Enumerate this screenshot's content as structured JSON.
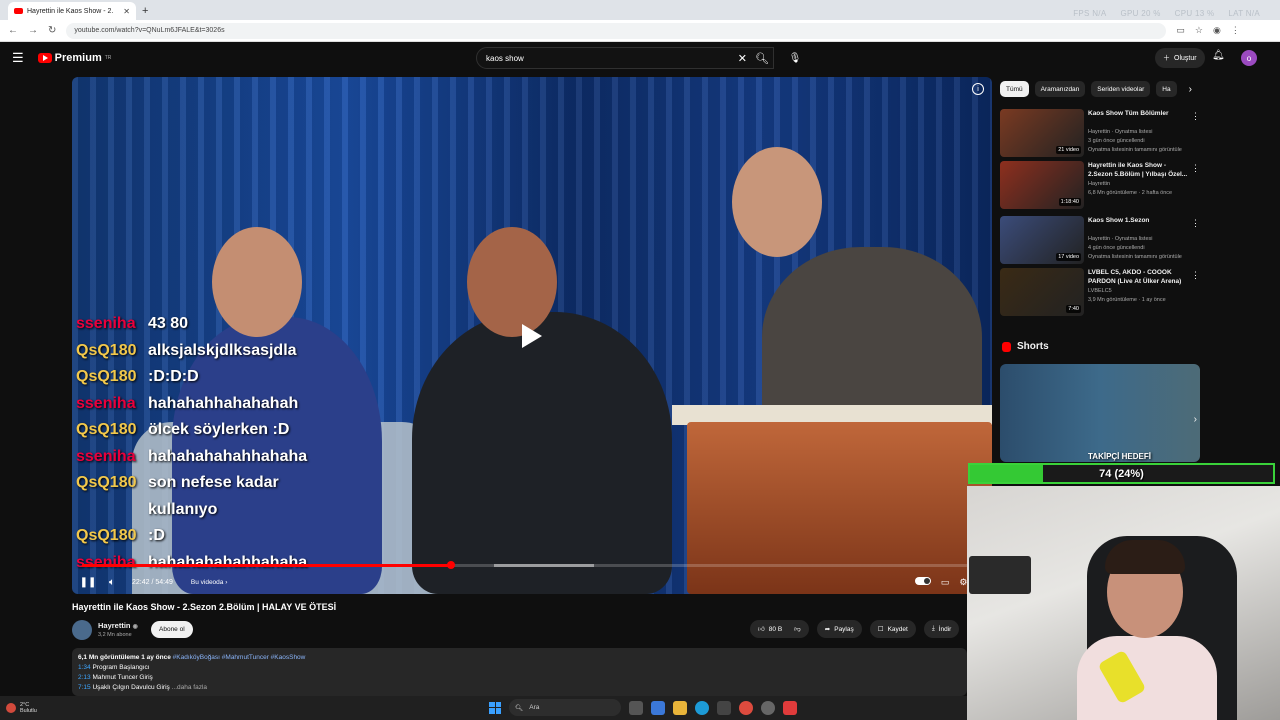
{
  "browser": {
    "tab_title": "Hayrettin ile Kaos Show - 2.",
    "url": "youtube.com/watch?v=QNuLm6JFALE&t=3026s",
    "perf": [
      "FPS N/A",
      "GPU 20 %",
      "CPU 13 %",
      "LAT N/A"
    ]
  },
  "header": {
    "logo_text": "Premium",
    "logo_sup": "TR",
    "search_value": "kaos show",
    "create_label": "Oluştur",
    "avatar_letter": "o"
  },
  "video": {
    "progress_fraction": 0.41,
    "time": "22:42 / 54:49",
    "chapter": "Bu videoda",
    "chat": [
      {
        "user": "sseniha",
        "color": "#e8003b",
        "msg": "43 80"
      },
      {
        "user": "QsQ180",
        "color": "#f2c84b",
        "msg": "alksjalskjdlksasjdla"
      },
      {
        "user": "QsQ180",
        "color": "#f2c84b",
        "msg": ":D:D:D"
      },
      {
        "user": "sseniha",
        "color": "#e8003b",
        "msg": "hahahahhahahahah"
      },
      {
        "user": "QsQ180",
        "color": "#f2c84b",
        "msg": "ölcek söylerken :D"
      },
      {
        "user": "sseniha",
        "color": "#e8003b",
        "msg": "hahahahahahhahaha"
      },
      {
        "user": "QsQ180",
        "color": "#f2c84b",
        "msg": "son nefese kadar"
      },
      {
        "user": "",
        "color": "#f2c84b",
        "msg": "kullanıyo"
      },
      {
        "user": "QsQ180",
        "color": "#f2c84b",
        "msg": ":D"
      },
      {
        "user": "sseniha",
        "color": "#e8003b",
        "msg": "hahahahahahhahaha"
      }
    ]
  },
  "details": {
    "title": "Hayrettin ile Kaos Show - 2.Sezon 2.Bölüm | HALAY VE ÖTESİ",
    "channel": "Hayrettin",
    "subs": "3,2 Mn abone",
    "subscribe": "Abone ol",
    "likes": "80 B",
    "share": "Paylaş",
    "save": "Kaydet",
    "download": "İndir",
    "stats": "6,1 Mn görüntüleme  1 ay önce",
    "tags": "#KadıköyBoğası #MahmutTuncer #KaosShow",
    "chapters": [
      {
        "ts": "1:34",
        "text": "Program Başlangıcı"
      },
      {
        "ts": "2:13",
        "text": "Mahmut Tuncer Giriş"
      },
      {
        "ts": "7:15",
        "text": "Uşaklı Çılgın Davulcu Giriş"
      }
    ],
    "more": "...daha fazla"
  },
  "sidebar": {
    "chips": [
      "Tümü",
      "Aramanızdan",
      "Seriden videolar",
      "Ha"
    ],
    "recs": [
      {
        "title": "Kaos Show Tüm Bölümler",
        "channel": "Hayrettin · Oynatma listesi",
        "meta": "3 gün önce güncellendi",
        "meta2": "Oynatma listesinin tamamını görüntüle",
        "badge": "21 video",
        "color": "#7a3a22"
      },
      {
        "title": "Hayrettin ile Kaos Show - 2.Sezon 5.Bölüm | Yılbaşı Özel...",
        "channel": "Hayrettin",
        "meta": "6,8 Mn görüntüleme · 2 hafta önce",
        "meta2": "",
        "badge": "1:18:40",
        "color": "#8e2f1e"
      },
      {
        "title": "Kaos Show 1.Sezon",
        "channel": "Hayrettin · Oynatma listesi",
        "meta": "4 gün önce güncellendi",
        "meta2": "Oynatma listesinin tamamını görüntüle",
        "badge": "17 video",
        "color": "#3b4c7a"
      },
      {
        "title": "LVBEL C5, AKDO - COOOK PARDON (Live At Ülker Arena)",
        "channel": "LVBELC5",
        "meta": "3,9 Mn görüntüleme · 1 ay önce",
        "meta2": "",
        "badge": "7:40",
        "color": "#3a2a15"
      }
    ],
    "shorts_title": "Shorts",
    "shorts_label": "TAKİPÇİ HEDEFİ"
  },
  "overlay": {
    "goal_text": "74 (24%)",
    "goal_fraction": 0.24
  },
  "taskbar": {
    "temp": "2°C",
    "weather": "Bulutlu",
    "search": "Ara"
  }
}
